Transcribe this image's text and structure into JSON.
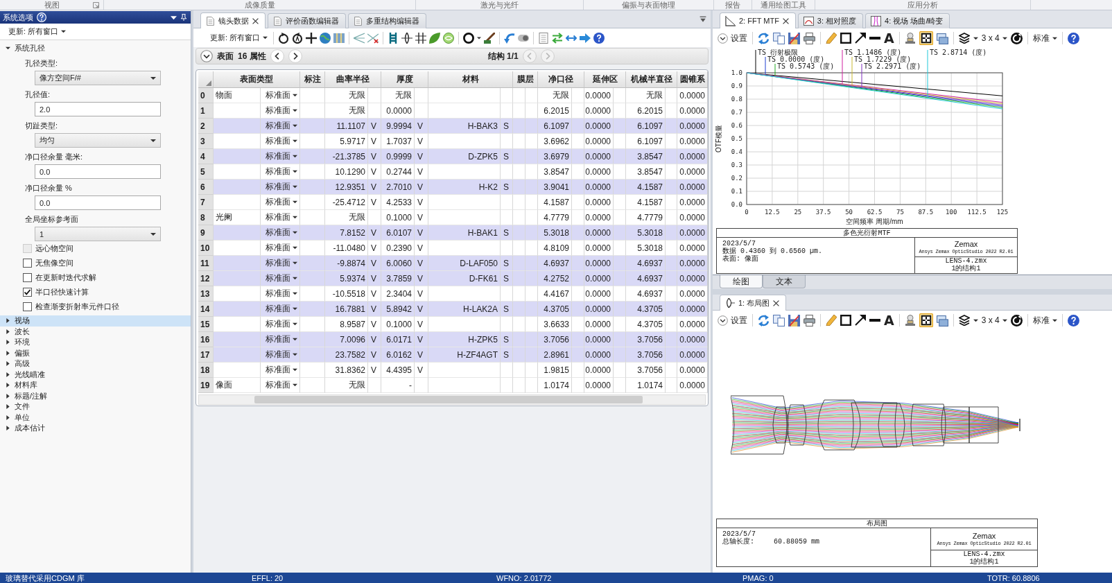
{
  "ribbon": {
    "groups": [
      "视图",
      "成像质量",
      "激光与光纤",
      "偏振与表面物理",
      "报告",
      "通用绘图工具",
      "应用分析"
    ]
  },
  "system_panel": {
    "title": "系统选项",
    "update": "更新: 所有窗口",
    "sections": [
      {
        "label": "系统孔径",
        "expanded": true,
        "selected": false,
        "fields": [
          {
            "kind": "dropdown",
            "label": "孔径类型:",
            "value": "像方空间F/#"
          },
          {
            "kind": "input",
            "label": "孔径值:",
            "value": "2.0"
          },
          {
            "kind": "dropdown",
            "label": "切趾类型:",
            "value": "均匀"
          },
          {
            "kind": "input",
            "label": "净口径余量 毫米:",
            "value": "0.0"
          },
          {
            "kind": "input",
            "label": "净口径余量 %",
            "value": "0.0"
          },
          {
            "kind": "dropdown",
            "label": "全局坐标参考面",
            "value": "1"
          }
        ],
        "options": [
          {
            "label": "远心物空间",
            "checked": false,
            "disabled": true
          },
          {
            "label": "无焦像空间",
            "checked": false,
            "disabled": false
          },
          {
            "label": "在更新时迭代求解",
            "checked": false,
            "disabled": false
          },
          {
            "label": "半口径快速计算",
            "checked": true,
            "disabled": false
          },
          {
            "label": "检查渐变折射率元件口径",
            "checked": false,
            "disabled": false
          }
        ]
      },
      {
        "label": "视场",
        "expanded": false,
        "selected": true
      },
      {
        "label": "波长",
        "expanded": false,
        "selected": false
      },
      {
        "label": "环境",
        "expanded": false,
        "selected": false
      },
      {
        "label": "偏振",
        "expanded": false,
        "selected": false
      },
      {
        "label": "高级",
        "expanded": false,
        "selected": false
      },
      {
        "label": "光线瞄准",
        "expanded": false,
        "selected": false
      },
      {
        "label": "材料库",
        "expanded": false,
        "selected": false
      },
      {
        "label": "标题/注解",
        "expanded": false,
        "selected": false
      },
      {
        "label": "文件",
        "expanded": false,
        "selected": false
      },
      {
        "label": "单位",
        "expanded": false,
        "selected": false
      },
      {
        "label": "成本估计",
        "expanded": false,
        "selected": false
      }
    ]
  },
  "editor": {
    "tabs": [
      {
        "label": "镜头数据",
        "selected": true
      },
      {
        "label": "评价函数编辑器",
        "selected": false
      },
      {
        "label": "多重结构编辑器",
        "selected": false
      }
    ],
    "update": "更新: 所有窗口",
    "surface_bar": {
      "label": "表面",
      "properties": "16 属性",
      "config": "结构 1/1",
      "surface_nav": {
        "disabled": false
      },
      "config_nav": {
        "disabled": true
      }
    },
    "table": {
      "columns": [
        "表面类型",
        "标注",
        "曲率半径",
        "厚度",
        "材料",
        "膜层",
        "净口径",
        "延伸区",
        "机械半直径",
        "圆锥系"
      ],
      "rows": [
        {
          "number": "0",
          "name": "物面",
          "type": "标准面",
          "radius": "无限",
          "thickness": "无限",
          "clear_semi_dia": "无限",
          "chip_zone": "0.0000",
          "mech_semi_dia": "无限",
          "conic": "0.0000"
        },
        {
          "number": "1",
          "type": "标准面",
          "radius": "无限",
          "thickness": "0.0000",
          "clear_semi_dia": "6.2015",
          "chip_zone": "0.0000",
          "mech_semi_dia": "6.2015",
          "conic": "0.0000"
        },
        {
          "number": "2",
          "type": "标准面",
          "radius": "11.1107",
          "radius_solve": "V",
          "thickness": "9.9994",
          "thickness_solve": "V",
          "material": "H-BAK3",
          "material_solve": "S",
          "clear_semi_dia": "6.1097",
          "chip_zone": "0.0000",
          "mech_semi_dia": "6.1097",
          "conic": "0.0000"
        },
        {
          "number": "3",
          "type": "标准面",
          "radius": "5.9717",
          "radius_solve": "V",
          "thickness": "1.7037",
          "thickness_solve": "V",
          "clear_semi_dia": "3.6962",
          "chip_zone": "0.0000",
          "mech_semi_dia": "6.1097",
          "conic": "0.0000"
        },
        {
          "number": "4",
          "type": "标准面",
          "radius": "-21.3785",
          "radius_solve": "V",
          "thickness": "0.9999",
          "thickness_solve": "V",
          "material": "D-ZPK5",
          "material_solve": "S",
          "clear_semi_dia": "3.6979",
          "chip_zone": "0.0000",
          "mech_semi_dia": "3.8547",
          "conic": "0.0000"
        },
        {
          "number": "5",
          "type": "标准面",
          "radius": "10.1290",
          "radius_solve": "V",
          "thickness": "0.2744",
          "thickness_solve": "V",
          "clear_semi_dia": "3.8547",
          "chip_zone": "0.0000",
          "mech_semi_dia": "3.8547",
          "conic": "0.0000"
        },
        {
          "number": "6",
          "type": "标准面",
          "radius": "12.9351",
          "radius_solve": "V",
          "thickness": "2.7010",
          "thickness_solve": "V",
          "material": "H-K2",
          "material_solve": "S",
          "clear_semi_dia": "3.9041",
          "chip_zone": "0.0000",
          "mech_semi_dia": "4.1587",
          "conic": "0.0000"
        },
        {
          "number": "7",
          "type": "标准面",
          "radius": "-25.4712",
          "radius_solve": "V",
          "thickness": "4.2533",
          "thickness_solve": "V",
          "clear_semi_dia": "4.1587",
          "chip_zone": "0.0000",
          "mech_semi_dia": "4.1587",
          "conic": "0.0000"
        },
        {
          "number": "8",
          "name": "光阑",
          "type": "标准面",
          "radius": "无限",
          "thickness": "0.1000",
          "thickness_solve": "V",
          "clear_semi_dia": "4.7779",
          "chip_zone": "0.0000",
          "mech_semi_dia": "4.7779",
          "conic": "0.0000"
        },
        {
          "number": "9",
          "type": "标准面",
          "radius": "7.8152",
          "radius_solve": "V",
          "thickness": "6.0107",
          "thickness_solve": "V",
          "material": "H-BAK1",
          "material_solve": "S",
          "clear_semi_dia": "5.3018",
          "chip_zone": "0.0000",
          "mech_semi_dia": "5.3018",
          "conic": "0.0000"
        },
        {
          "number": "10",
          "type": "标准面",
          "radius": "-11.0480",
          "radius_solve": "V",
          "thickness": "0.2390",
          "thickness_solve": "V",
          "clear_semi_dia": "4.8109",
          "chip_zone": "0.0000",
          "mech_semi_dia": "5.3018",
          "conic": "0.0000"
        },
        {
          "number": "11",
          "type": "标准面",
          "radius": "-9.8874",
          "radius_solve": "V",
          "thickness": "6.0060",
          "thickness_solve": "V",
          "material": "D-LAF050",
          "material_solve": "S",
          "clear_semi_dia": "4.6937",
          "chip_zone": "0.0000",
          "mech_semi_dia": "4.6937",
          "conic": "0.0000"
        },
        {
          "number": "12",
          "type": "标准面",
          "radius": "5.9374",
          "radius_solve": "V",
          "thickness": "3.7859",
          "thickness_solve": "V",
          "material": "D-FK61",
          "material_solve": "S",
          "clear_semi_dia": "4.2752",
          "chip_zone": "0.0000",
          "mech_semi_dia": "4.6937",
          "conic": "0.0000"
        },
        {
          "number": "13",
          "type": "标准面",
          "radius": "-10.5518",
          "radius_solve": "V",
          "thickness": "2.3404",
          "thickness_solve": "V",
          "clear_semi_dia": "4.4167",
          "chip_zone": "0.0000",
          "mech_semi_dia": "4.6937",
          "conic": "0.0000"
        },
        {
          "number": "14",
          "type": "标准面",
          "radius": "16.7881",
          "radius_solve": "V",
          "thickness": "5.8942",
          "thickness_solve": "V",
          "material": "H-LAK2A",
          "material_solve": "S",
          "clear_semi_dia": "4.3705",
          "chip_zone": "0.0000",
          "mech_semi_dia": "4.3705",
          "conic": "0.0000"
        },
        {
          "number": "15",
          "type": "标准面",
          "radius": "8.9587",
          "radius_solve": "V",
          "thickness": "0.1000",
          "thickness_solve": "V",
          "clear_semi_dia": "3.6633",
          "chip_zone": "0.0000",
          "mech_semi_dia": "4.3705",
          "conic": "0.0000"
        },
        {
          "number": "16",
          "type": "标准面",
          "radius": "7.0096",
          "radius_solve": "V",
          "thickness": "6.0171",
          "thickness_solve": "V",
          "material": "H-ZPK5",
          "material_solve": "S",
          "clear_semi_dia": "3.7056",
          "chip_zone": "0.0000",
          "mech_semi_dia": "3.7056",
          "conic": "0.0000"
        },
        {
          "number": "17",
          "type": "标准面",
          "radius": "23.7582",
          "radius_solve": "V",
          "thickness": "6.0162",
          "thickness_solve": "V",
          "material": "H-ZF4AGT",
          "material_solve": "S",
          "clear_semi_dia": "2.8961",
          "chip_zone": "0.0000",
          "mech_semi_dia": "3.7056",
          "conic": "0.0000"
        },
        {
          "number": "18",
          "type": "标准面",
          "radius": "31.8362",
          "radius_solve": "V",
          "thickness": "4.4395",
          "thickness_solve": "V",
          "clear_semi_dia": "1.9815",
          "chip_zone": "0.0000",
          "mech_semi_dia": "3.7056",
          "conic": "0.0000"
        },
        {
          "number": "19",
          "name": "像面",
          "type": "标准面",
          "radius": "无限",
          "thickness": "-",
          "clear_semi_dia": "1.0174",
          "chip_zone": "0.0000",
          "mech_semi_dia": "1.0174",
          "conic": "0.0000"
        }
      ]
    }
  },
  "mtf_panel": {
    "tabs": [
      {
        "label": "2: FFT MTF",
        "selected": true
      },
      {
        "label": "3: 相对照度",
        "selected": false
      },
      {
        "label": "4: 视场 场曲/畸变",
        "selected": false
      }
    ],
    "toolbar": {
      "settings": "设置",
      "text_tool": "A",
      "crosshair_on": true,
      "grid": "3 x 4",
      "preset": "标准"
    },
    "chart_data": {
      "type": "line",
      "title": "多色光衍射MTF",
      "xlabel": "空间频率 周期/mm",
      "ylabel": "OTF模量",
      "x": [
        0,
        125
      ],
      "xlim": [
        0,
        125
      ],
      "ylim": [
        0,
        1
      ],
      "xticks": [
        0,
        12.5,
        25,
        37.5,
        50,
        62.5,
        75,
        87.5,
        100,
        112.5,
        125
      ],
      "yticks": [
        {
          "value": 0,
          "label": "0.0"
        },
        0.1,
        0.2,
        0.3,
        0.4,
        0.5,
        0.6,
        0.7,
        0.8,
        0.9,
        {
          "value": 1,
          "label": "1.0"
        }
      ],
      "grid": true,
      "series": [
        {
          "name": "TS 衍射极限",
          "color": "#000000",
          "values": [
            1,
            0.825
          ]
        },
        {
          "name": "TS 0.0000 (度)",
          "color": "#1f3fd0",
          "values": [
            1,
            0.746
          ]
        },
        {
          "name": "TS 0.5743 (度)",
          "color": "#22aa22",
          "values": [
            1,
            0.736
          ]
        },
        {
          "name": "TS 1.1486 (度)",
          "color": "#d020a0",
          "values": [
            1,
            0.776
          ]
        },
        {
          "name": "TS 1.7229 (度)",
          "color": "#c8b830",
          "values": [
            1,
            0.766
          ]
        },
        {
          "name": "TS 2.2971 (度)",
          "color": "#8030c0",
          "values": [
            1,
            0.756
          ]
        },
        {
          "name": "TS 2.8714 (度)",
          "color": "#20c8d8",
          "values": [
            1,
            0.726
          ]
        }
      ]
    },
    "title_block": {
      "date": "2023/5/7",
      "notes": [
        "数据 0.4360 到 0.6560 µm.",
        "表面: 像面"
      ],
      "brand": "Zemax",
      "product": "Ansys Zemax OpticStudio 2022 R2.01",
      "file": "LENS-4.zmx",
      "config": "1的结构1"
    },
    "view_tabs": [
      {
        "label": "绘图",
        "selected": true
      },
      {
        "label": "文本",
        "selected": false
      }
    ]
  },
  "layout_panel": {
    "tabs": [
      {
        "label": "1: 布局图",
        "selected": true
      }
    ],
    "toolbar": {
      "settings": "设置",
      "text_tool": "A",
      "crosshair_on": true,
      "grid": "3 x 4",
      "preset": "标准"
    },
    "title_block": {
      "title": "布局图",
      "date": "2023/5/7",
      "fields": [
        {
          "label": "总轴长度:",
          "value": "60.88059 mm"
        }
      ],
      "brand": "Zemax",
      "product": "Ansys Zemax OpticStudio 2022 R2.01",
      "file": "LENS-4.zmx",
      "config": "1的结构1"
    }
  },
  "status_bar": [
    "玻璃替代采用CDGM 库",
    "EFFL: 20",
    "WFNO: 2.01772",
    "PMAG: 0",
    "TOTR: 60.8806"
  ]
}
